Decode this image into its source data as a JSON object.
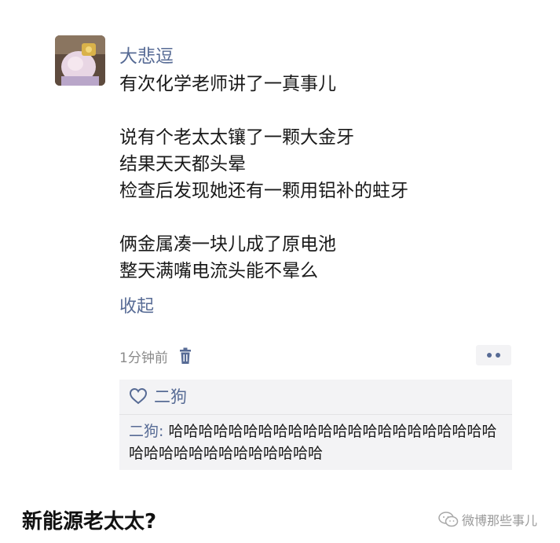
{
  "post": {
    "author": "大悲逗",
    "text": "有次化学老师讲了一真事儿\n\n说有个老太太镶了一颗大金牙\n结果天天都头晕\n检查后发现她还有一颗用铝补的蛀牙\n\n俩金属凑一块儿成了原电池\n整天满嘴电流头能不晕么",
    "collapse_label": "收起",
    "time": "1分钟前"
  },
  "likes": {
    "names": "二狗"
  },
  "comment": {
    "author": "二狗:",
    "text": " 哈哈哈哈哈哈哈哈哈哈哈哈哈哈哈哈哈哈哈哈哈哈哈哈哈哈哈哈哈哈哈哈哈哈哈"
  },
  "footer": {
    "title": "新能源老太太?",
    "watermark": "微博那些事儿"
  },
  "colors": {
    "link": "#576b95",
    "panel": "#f3f3f5"
  },
  "icons": [
    "avatar-image",
    "trash-icon",
    "more-dots-icon",
    "heart-icon",
    "wechat-watermark-icon"
  ]
}
